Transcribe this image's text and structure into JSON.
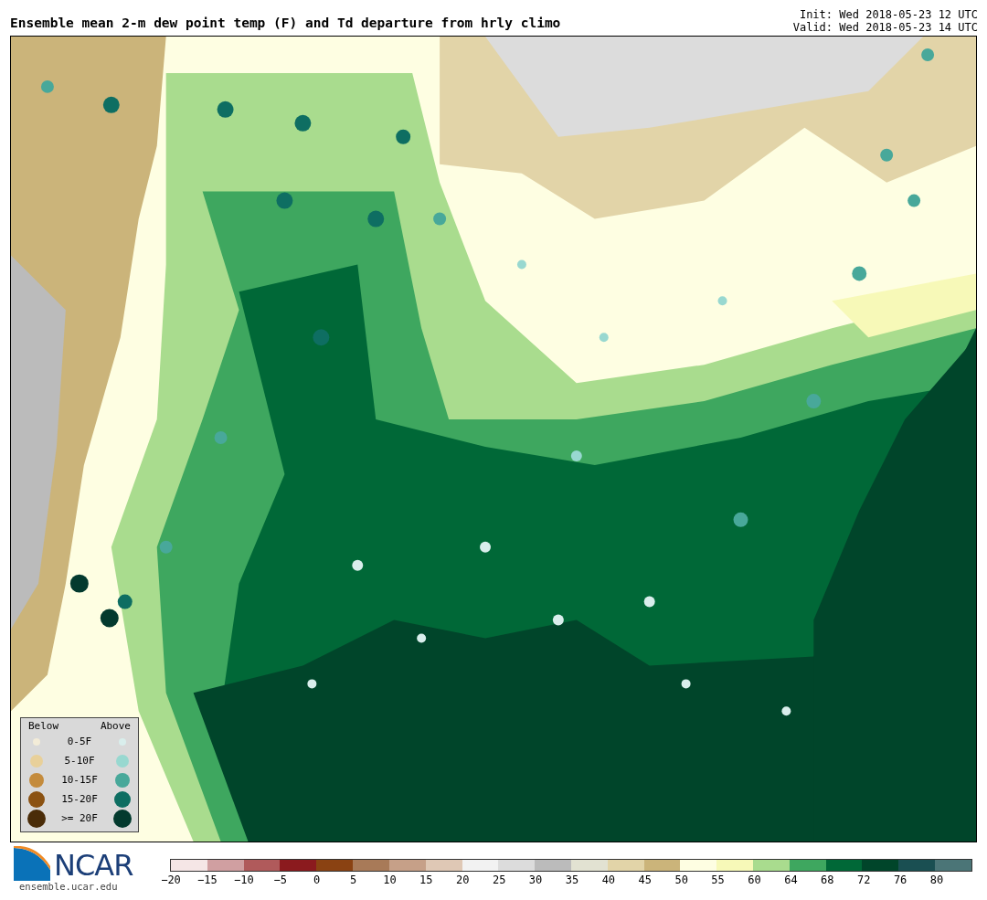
{
  "title": "Ensemble mean 2-m dew point temp (F) and Td departure from hrly climo",
  "init": "Init: Wed 2018-05-23 12 UTC",
  "valid": "Valid: Wed 2018-05-23 14 UTC",
  "legend": {
    "below_heading": "Below",
    "above_heading": "Above",
    "rows": [
      {
        "label": "0-5F",
        "below": {
          "color": "#f3ecd8"
        },
        "above": {
          "color": "#d9eeec"
        }
      },
      {
        "label": "5-10F",
        "below": {
          "color": "#e8d09a"
        },
        "above": {
          "color": "#98d8d0"
        }
      },
      {
        "label": "10-15F",
        "below": {
          "color": "#c48b3c"
        },
        "above": {
          "color": "#48a89a"
        }
      },
      {
        "label": "15-20F",
        "below": {
          "color": "#8b5212"
        },
        "above": {
          "color": "#0e6e62"
        }
      },
      {
        "label": ">= 20F",
        "below": {
          "color": "#4a2c08"
        },
        "above": {
          "color": "#033a2e"
        }
      }
    ]
  },
  "logo": {
    "text": "NCAR",
    "url": "ensemble.ucar.edu"
  },
  "colorbar": [
    {
      "tick": "−20",
      "color": "#f5e6e6"
    },
    {
      "tick": "−15",
      "color": "#d09fa1"
    },
    {
      "tick": "−10",
      "color": "#b05a5b"
    },
    {
      "tick": "−5",
      "color": "#8b1a1e"
    },
    {
      "tick": "0",
      "color": "#8a4212"
    },
    {
      "tick": "5",
      "color": "#a87a58"
    },
    {
      "tick": "10",
      "color": "#c6a088"
    },
    {
      "tick": "15",
      "color": "#dfc8b5"
    },
    {
      "tick": "20",
      "color": "#f2f2f2"
    },
    {
      "tick": "25",
      "color": "#dcdcdc"
    },
    {
      "tick": "30",
      "color": "#bbbbbb"
    },
    {
      "tick": "35",
      "color": "#e2e2d2"
    },
    {
      "tick": "40",
      "color": "#e2d4a8"
    },
    {
      "tick": "45",
      "color": "#cbb47a"
    },
    {
      "tick": "50",
      "color": "#fefee2"
    },
    {
      "tick": "55",
      "color": "#f7f9b8"
    },
    {
      "tick": "60",
      "color": "#a9dc8e"
    },
    {
      "tick": "64",
      "color": "#3ea75f"
    },
    {
      "tick": "68",
      "color": "#006837"
    },
    {
      "tick": "72",
      "color": "#00452a"
    },
    {
      "tick": "76",
      "color": "#1a4f52"
    },
    {
      "tick": "80",
      "color": "#4b7577"
    }
  ]
}
